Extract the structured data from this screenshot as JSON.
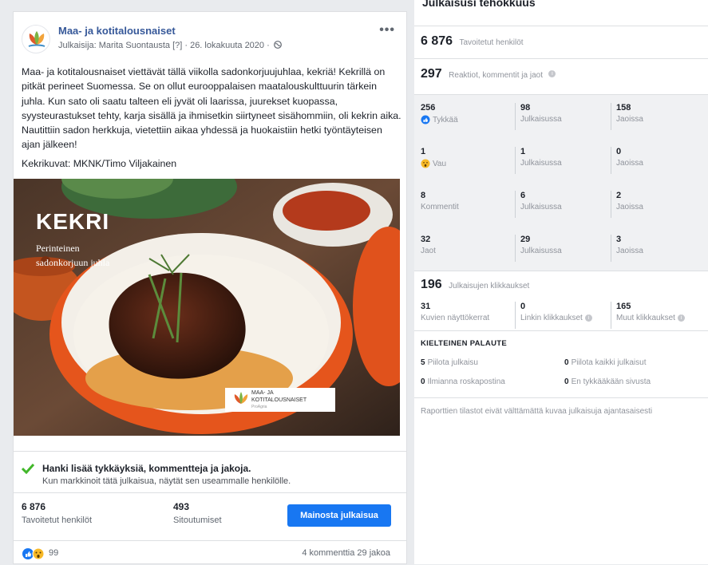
{
  "post": {
    "page_name": "Maa- ja kotitalousnaiset",
    "meta": "Julkaisija: Marita Suontausta [?] · 26. lokakuuta 2020 ·",
    "more": "•••",
    "text_p1": "Maa- ja kotitalousnaiset viettävät tällä viikolla sadonkorjuujuhlaa, kekriä! Kekrillä on pitkät perineet Suomessa. Se on ollut eurooppalaisen maatalouskulttuurin tärkein juhla. Kun sato oli saatu talteen eli jyvät oli laarissa, juurekset kuopassa, syysteurastukset tehty, karja sisällä ja ihmisetkin siirtyneet sisähommiin, oli kekrin aika. Nautittiin sadon herkkuja, vietettiin aikaa yhdessä ja huokaistiin hetki työntäyteisen ajan jälkeen!",
    "text_p2": "Kekrikuvat: MKNK/Timo Viljakainen",
    "image": {
      "headline": "KEKRI",
      "sub1": "Perinteinen",
      "sub2": "sadonkorjuun juhla",
      "logo_line1": "MAA- JA",
      "logo_line2": "KOTITALOUSNAISET",
      "logo_line3": "ProAgria"
    },
    "promo_title": "Hanki lisää tykkäyksiä, kommentteja ja jakoja.",
    "promo_sub": "Kun markkinoit tätä julkaisua, näytät sen useammalle henkilölle.",
    "reach_value": "6 876",
    "reach_label": "Tavoitetut henkilöt",
    "engagement_value": "493",
    "engagement_label": "Sitoutumiset",
    "promote_button": "Mainosta julkaisua",
    "reactions_count": "99",
    "comments_shares": "4 kommenttia  29 jakoa"
  },
  "panel": {
    "title": "Julkaisusi tehokkuus",
    "reach_value": "6 876",
    "reach_label": "Tavoitetut henkilöt",
    "engagement_value": "297",
    "engagement_label": "Reaktiot, kommentit ja jaot",
    "grid": [
      {
        "v1": "256",
        "l1": "Tykkää",
        "v2": "98",
        "l2": "Julkaisussa",
        "v3": "158",
        "l3": "Jaoissa"
      },
      {
        "v1": "1",
        "l1": "Vau",
        "v2": "1",
        "l2": "Julkaisussa",
        "v3": "0",
        "l3": "Jaoissa"
      },
      {
        "v1": "8",
        "l1": "Kommentit",
        "v2": "6",
        "l2": "Julkaisussa",
        "v3": "2",
        "l3": "Jaoissa"
      },
      {
        "v1": "32",
        "l1": "Jaot",
        "v2": "29",
        "l2": "Julkaisussa",
        "v3": "3",
        "l3": "Jaoissa"
      }
    ],
    "clicks_value": "196",
    "clicks_label": "Julkaisujen klikkaukset",
    "clicks": [
      {
        "v": "31",
        "l": "Kuvien näyttökerrat"
      },
      {
        "v": "0",
        "l": "Linkin klikkaukset"
      },
      {
        "v": "165",
        "l": "Muut klikkaukset"
      }
    ],
    "negative_title": "KIELTEINEN PALAUTE",
    "negative": [
      {
        "v": "5",
        "l": "Piilota julkaisu"
      },
      {
        "v": "0",
        "l": "Piilota kaikki julkaisut"
      },
      {
        "v": "0",
        "l": "Ilmianna roskapostina"
      },
      {
        "v": "0",
        "l": "En tykkääkään sivusta"
      }
    ],
    "disclaimer": "Raporttien tilastot eivät välttämättä kuvaa julkaisuja ajantasaisesti"
  },
  "colors": {
    "link": "#365899",
    "button": "#1877f2",
    "like": "#1877f2",
    "check": "#42b72a"
  }
}
